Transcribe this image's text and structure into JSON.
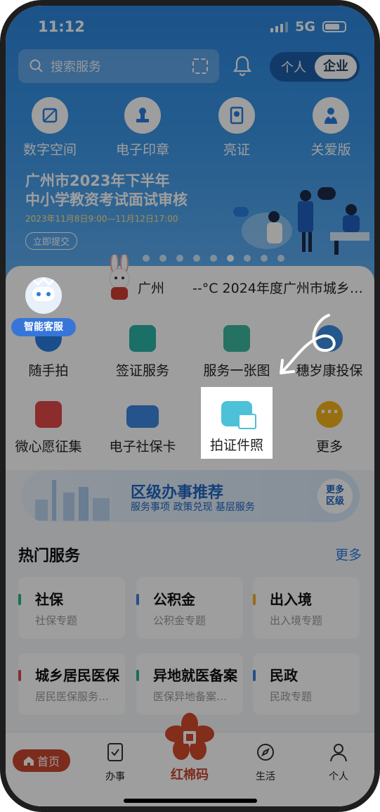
{
  "status": {
    "time": "11:12",
    "network": "5G"
  },
  "search": {
    "placeholder": "搜索服务"
  },
  "toggle": {
    "personal": "个人",
    "enterprise": "企业"
  },
  "top_shortcuts": [
    {
      "label": "数字空间",
      "icon": "digital-space-icon"
    },
    {
      "label": "电子印章",
      "icon": "seal-icon"
    },
    {
      "label": "亮证",
      "icon": "certificate-icon"
    },
    {
      "label": "关爱版",
      "icon": "care-icon"
    }
  ],
  "banner": {
    "title_line1": "广州市2023年下半年",
    "title_line2": "中小学教资考试面试审核",
    "date": "2023年11月8日9:00—11月12日17:00",
    "button": "立即提交"
  },
  "assistant": {
    "label": "智能客服"
  },
  "weather": {
    "city": "广州",
    "info": "--°C 2024年度广州市城乡…"
  },
  "services": [
    {
      "label": "随手拍",
      "color": "#2a7de1"
    },
    {
      "label": "签证服务",
      "color": "#2bb3a5"
    },
    {
      "label": "服务一张图",
      "color": "#3cb8a0"
    },
    {
      "label": "穗岁康投保",
      "color": "#3a8de0"
    },
    {
      "label": "微心愿征集",
      "color": "#e0484a"
    },
    {
      "label": "电子社保卡",
      "color": "#3d86e0"
    },
    {
      "label": "拍证件照",
      "color": "#4cc1d8"
    },
    {
      "label": "更多",
      "color": "#f5b31a"
    }
  ],
  "recommend": {
    "title": "区级办事推荐",
    "subtitle": "服务事项 政策兑现 基层服务",
    "more": "更多区级"
  },
  "hot": {
    "title": "热门服务",
    "more": "更多",
    "cards": [
      {
        "title": "社保",
        "sub": "社保专题",
        "color": "#2bb38b"
      },
      {
        "title": "公积金",
        "sub": "公积金专题",
        "color": "#3d7fe0"
      },
      {
        "title": "出入境",
        "sub": "出入境专题",
        "color": "#f2b32a"
      },
      {
        "title": "城乡居民医保",
        "sub": "居民医保服务…",
        "color": "#e04848"
      },
      {
        "title": "异地就医备案",
        "sub": "医保异地备案…",
        "color": "#2bb38b"
      },
      {
        "title": "民政",
        "sub": "民政专题",
        "color": "#3d7fe0"
      }
    ]
  },
  "tabbar": {
    "home": "首页",
    "work": "办事",
    "center": "红棉码",
    "life": "生活",
    "me": "个人"
  }
}
